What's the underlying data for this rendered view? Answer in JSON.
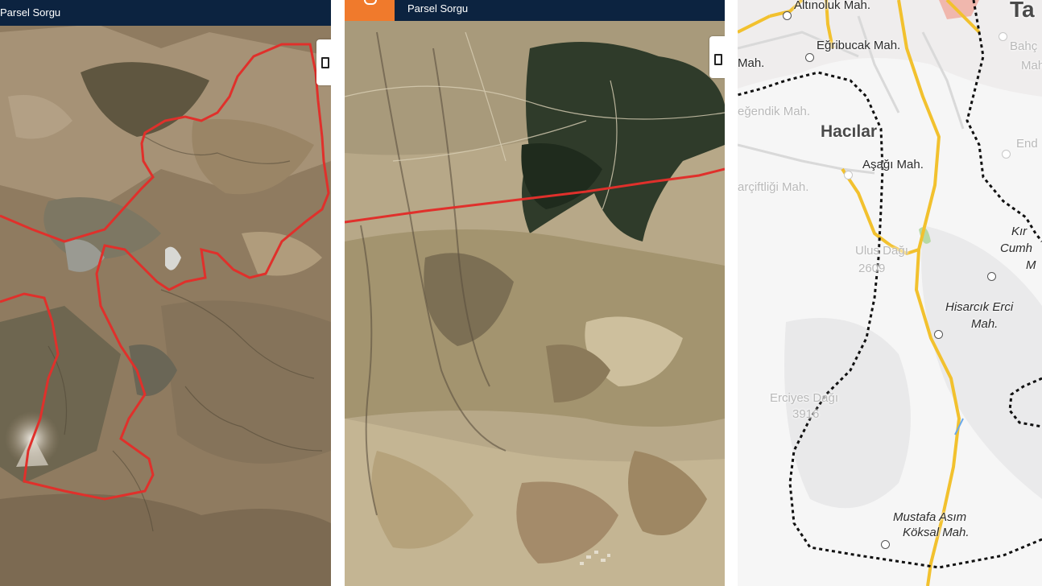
{
  "panels": {
    "satellite_overview": {
      "app_bar": {
        "title": "Parsel Sorgu"
      },
      "layer_button_icon": "layers-icon",
      "boundary_color": "#e0302b"
    },
    "satellite_detail": {
      "app_bar": {
        "title": "Parsel Sorgu"
      },
      "logo_color": "#f07a2c",
      "layer_button_icon": "layers-icon",
      "boundary_color": "#e0302b"
    },
    "street_map": {
      "road_color": "#f2c12e",
      "boundary_style": "dashed-black",
      "labels": {
        "altinoluk": "Altınoluk Mah.",
        "egribucak": "Eğribucak Mah.",
        "ta": "Ta",
        "mah_left": "Mah.",
        "bahce": "Bahç",
        "mah_right": "Mah",
        "egendik": "eğendik Mah.",
        "hacilar": "Hacılar",
        "end": "End",
        "asagi": "Aşağı Mah.",
        "arciftligi": "arçiftliği Mah.",
        "kir": "Kır",
        "cum": "Cumh",
        "m": "M",
        "ulus_dagi": "Ulus Dağı",
        "ulus_elev": "2609",
        "hisarcik_1": "Hisarcık Erci",
        "hisarcik_2": "Mah.",
        "erciyes": "Erciyes Dağı",
        "erciyes_elev": "3916",
        "mustafa_1": "Mustafa Asım",
        "mustafa_2": "Köksal Mah."
      }
    }
  }
}
